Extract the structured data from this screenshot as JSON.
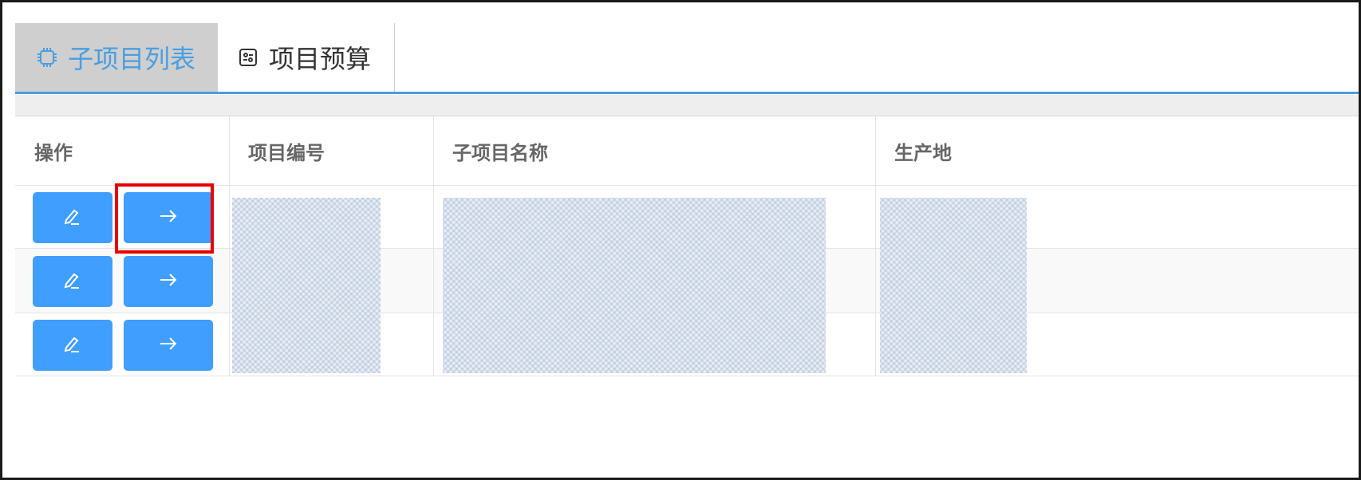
{
  "tabs": [
    {
      "label": "子项目列表",
      "icon": "chip-icon",
      "active": true
    },
    {
      "label": "项目预算",
      "icon": "budget-icon",
      "active": false
    }
  ],
  "table": {
    "columns": [
      "操作",
      "项目编号",
      "子项目名称",
      "生产地"
    ],
    "rows": [
      {
        "actions": [
          "edit-icon",
          "arrow-right-icon"
        ]
      },
      {
        "actions": [
          "edit-icon",
          "arrow-right-icon"
        ]
      },
      {
        "actions": [
          "edit-icon",
          "arrow-right-icon"
        ]
      }
    ]
  },
  "colors": {
    "accent": "#409eff",
    "tab_active_bg": "#cfcfcf",
    "tab_underline": "#4a9ee0",
    "highlight": "#e60000"
  }
}
